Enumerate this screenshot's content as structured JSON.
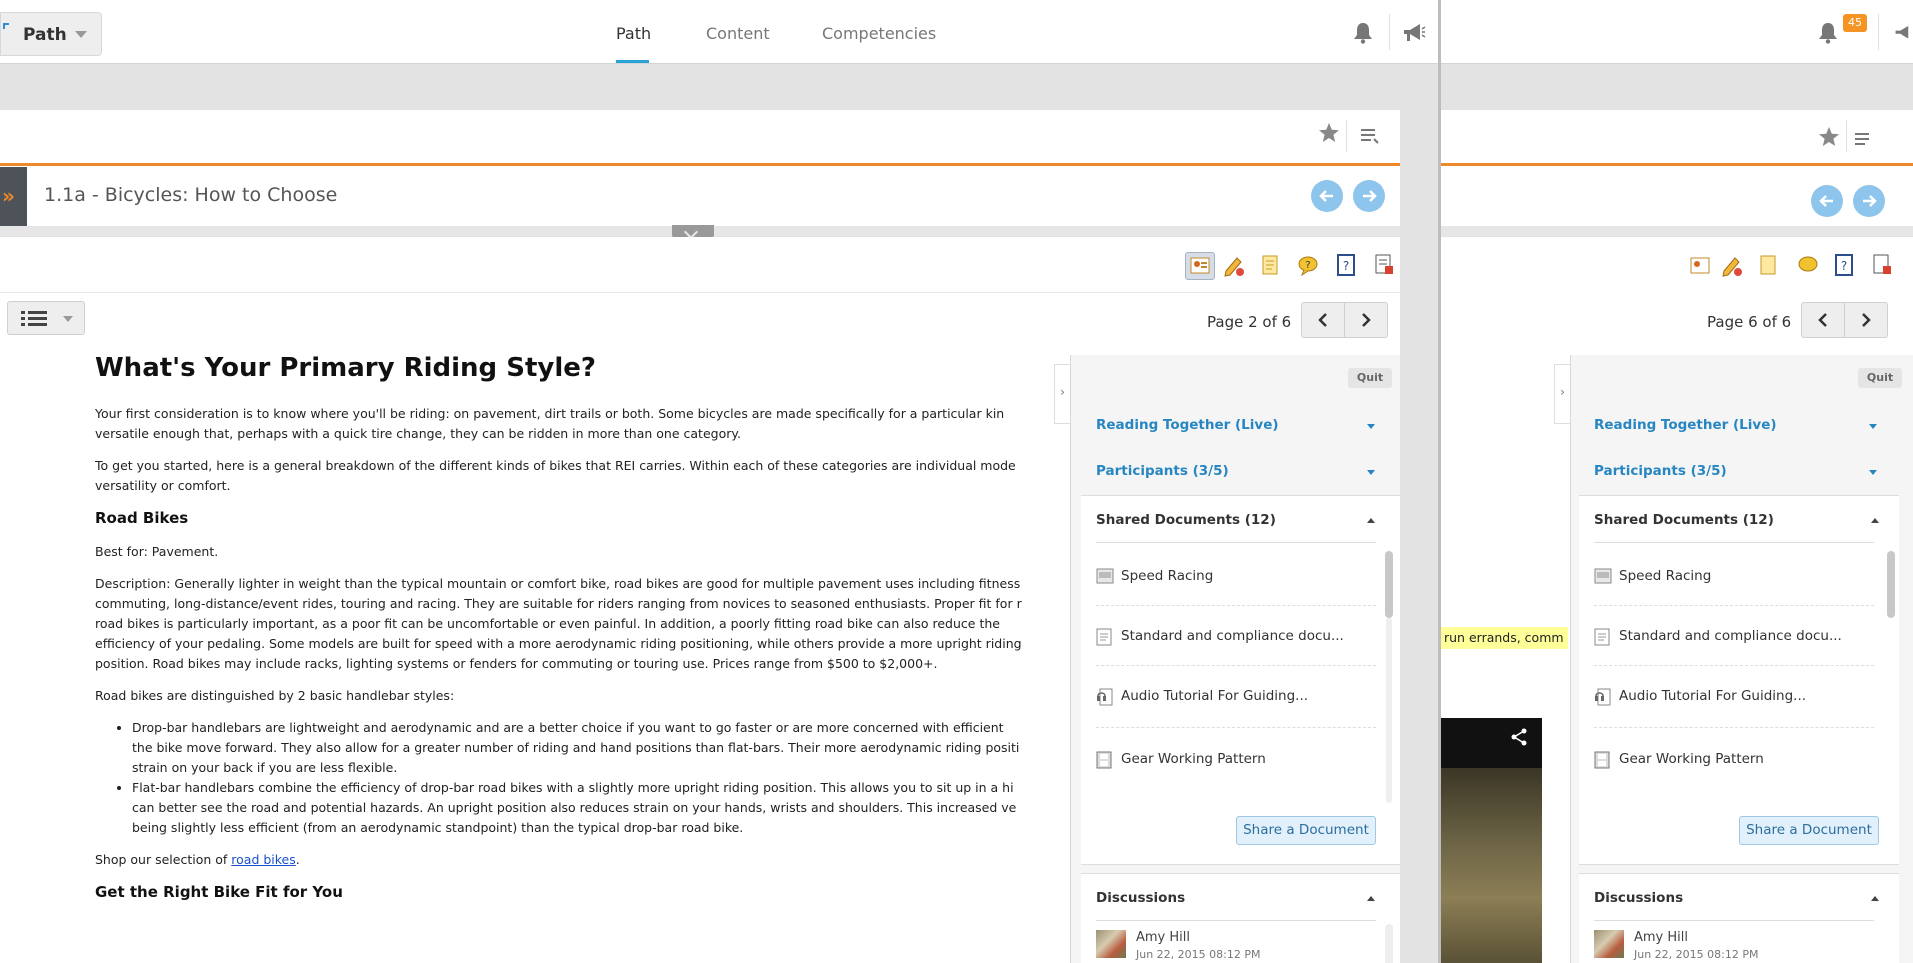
{
  "nav": {
    "path_label": "Path",
    "tabs": [
      "Path",
      "Content",
      "Competencies"
    ],
    "notification_count": "45"
  },
  "lesson": {
    "title": "1.1a - Bicycles: How to Choose",
    "page_indicator_left": "Page 2 of 6",
    "page_indicator_right": "Page 6 of 6"
  },
  "article": {
    "heading": "What's Your Primary Riding Style?",
    "p1_line1": "Your first consideration is to know where you'll be riding: on pavement, dirt trails or both. Some bicycles are made specifically for a particular kin",
    "p1_line2": "versatile enough that, perhaps with a quick tire change, they can be ridden in more than one category.",
    "p2_line1": "To get you started, here is a general breakdown of the different kinds of bikes that REI carries. Within each of these categories are individual mode",
    "p2_line2": "versatility or comfort.",
    "road_heading": "Road Bikes",
    "best_for": "Best for: Pavement.",
    "desc_lines": [
      "Description: Generally lighter in weight than the typical mountain or comfort bike, road bikes are good for multiple pavement uses including fitness",
      "commuting, long-distance/event rides, touring and racing. They are suitable for riders ranging from novices to seasoned enthusiasts. Proper fit for r",
      "road bikes is particularly important, as a poor fit can be uncomfortable or even painful. In addition, a poorly fitting road bike can also reduce the",
      "efficiency of your pedaling. Some models are built for speed with a more aerodynamic riding positioning, while others provide a more upright riding",
      "position. Road bikes may include racks, lighting systems or fenders for commuting or touring use. Prices range from $500 to $2,000+."
    ],
    "handlebar_intro": "Road bikes are distinguished by 2 basic handlebar styles:",
    "bullet1_lines": [
      "Drop-bar handlebars are lightweight and aerodynamic and are a better choice if you want to go faster or are more concerned with efficient",
      "the bike move forward. They also allow for a greater number of riding and hand positions than flat-bars. Their more aerodynamic riding positi",
      "strain on your back if you are less flexible."
    ],
    "bullet2_lines": [
      "Flat-bar handlebars combine the efficiency of drop-bar road bikes with a slightly more upright riding position. This allows you to sit up in a hi",
      "can better see the road and potential hazards. An upright position also reduces strain on your hands, wrists and shoulders. This increased ve",
      "being slightly less efficient (from an aerodynamic standpoint) than the typical drop-bar road bike."
    ],
    "shop_prefix": "Shop our selection of ",
    "shop_link": "road bikes",
    "shop_suffix": ".",
    "fit_heading": "Get the Right Bike Fit for You"
  },
  "panel": {
    "quit_label": "Quit",
    "reading_together": "Reading Together (Live)",
    "participants": "Participants (3/5)",
    "shared_docs_title": "Shared Documents (12)",
    "documents": [
      "Speed Racing",
      "Standard and compliance docu...",
      "Audio Tutorial For Guiding...",
      "Gear Working Pattern"
    ],
    "share_button": "Share a Document",
    "discussions_title": "Discussions",
    "author": "Amy Hill",
    "timestamp": "Jun 22, 2015 08:12 PM"
  },
  "right_page": {
    "highlight_text": "run errands, comm"
  },
  "colors": {
    "accent_orange": "#ef8a2c",
    "link_blue": "#2786c2",
    "tab_underline": "#29a3d9",
    "badge_orange": "#f39424"
  }
}
